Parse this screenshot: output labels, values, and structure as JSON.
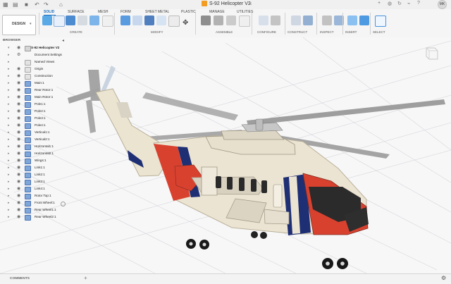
{
  "titlebar": {
    "document_title": "S-92 Helicopter V2",
    "user_initials": "MK"
  },
  "toolbar": {
    "mode_button": "DESIGN",
    "tabs": [
      "SOLID",
      "SURFACE",
      "MESH",
      "FORM",
      "SHEET METAL",
      "PLASTIC",
      "MANAGE",
      "UTILITIES"
    ],
    "groups": [
      "CREATE",
      "MODIFY",
      "ASSEMBLE",
      "CONFIGURE",
      "CONSTRUCT",
      "INSPECT",
      "INSERT",
      "SELECT"
    ]
  },
  "browser": {
    "header": "BROWSER",
    "root": "S-92 Helicopter V2",
    "items": [
      "Document Settings",
      "Named Views",
      "Origin",
      "Construction",
      "Main:1",
      "Rear Rotor:1",
      "Main Rotor:1",
      "Pole1:1",
      "Pole2:1",
      "Pole3:1",
      "Pole4:1",
      "Vertical1:1",
      "Vertical2:1",
      "Horizontal1:1",
      "Horizontal2:1",
      "Wings:1",
      "Link1:1",
      "Link2:1",
      "Link3:1",
      "Link4:1",
      "Rotor Top:1",
      "Front Wheel:1",
      "Rear Wheel1:1",
      "Rear Wheel2:1"
    ]
  },
  "comments": {
    "label": "COMMENTS"
  },
  "colors": {
    "accent": "#2f7fd1",
    "body_cream": "#ece4d2",
    "body_red": "#d9412f",
    "dark_stripe": "#1f2f74"
  },
  "icons": {
    "grid": "grid-icon",
    "save": "save-icon",
    "undo": "undo-icon",
    "redo": "redo-icon",
    "home": "home-icon"
  }
}
